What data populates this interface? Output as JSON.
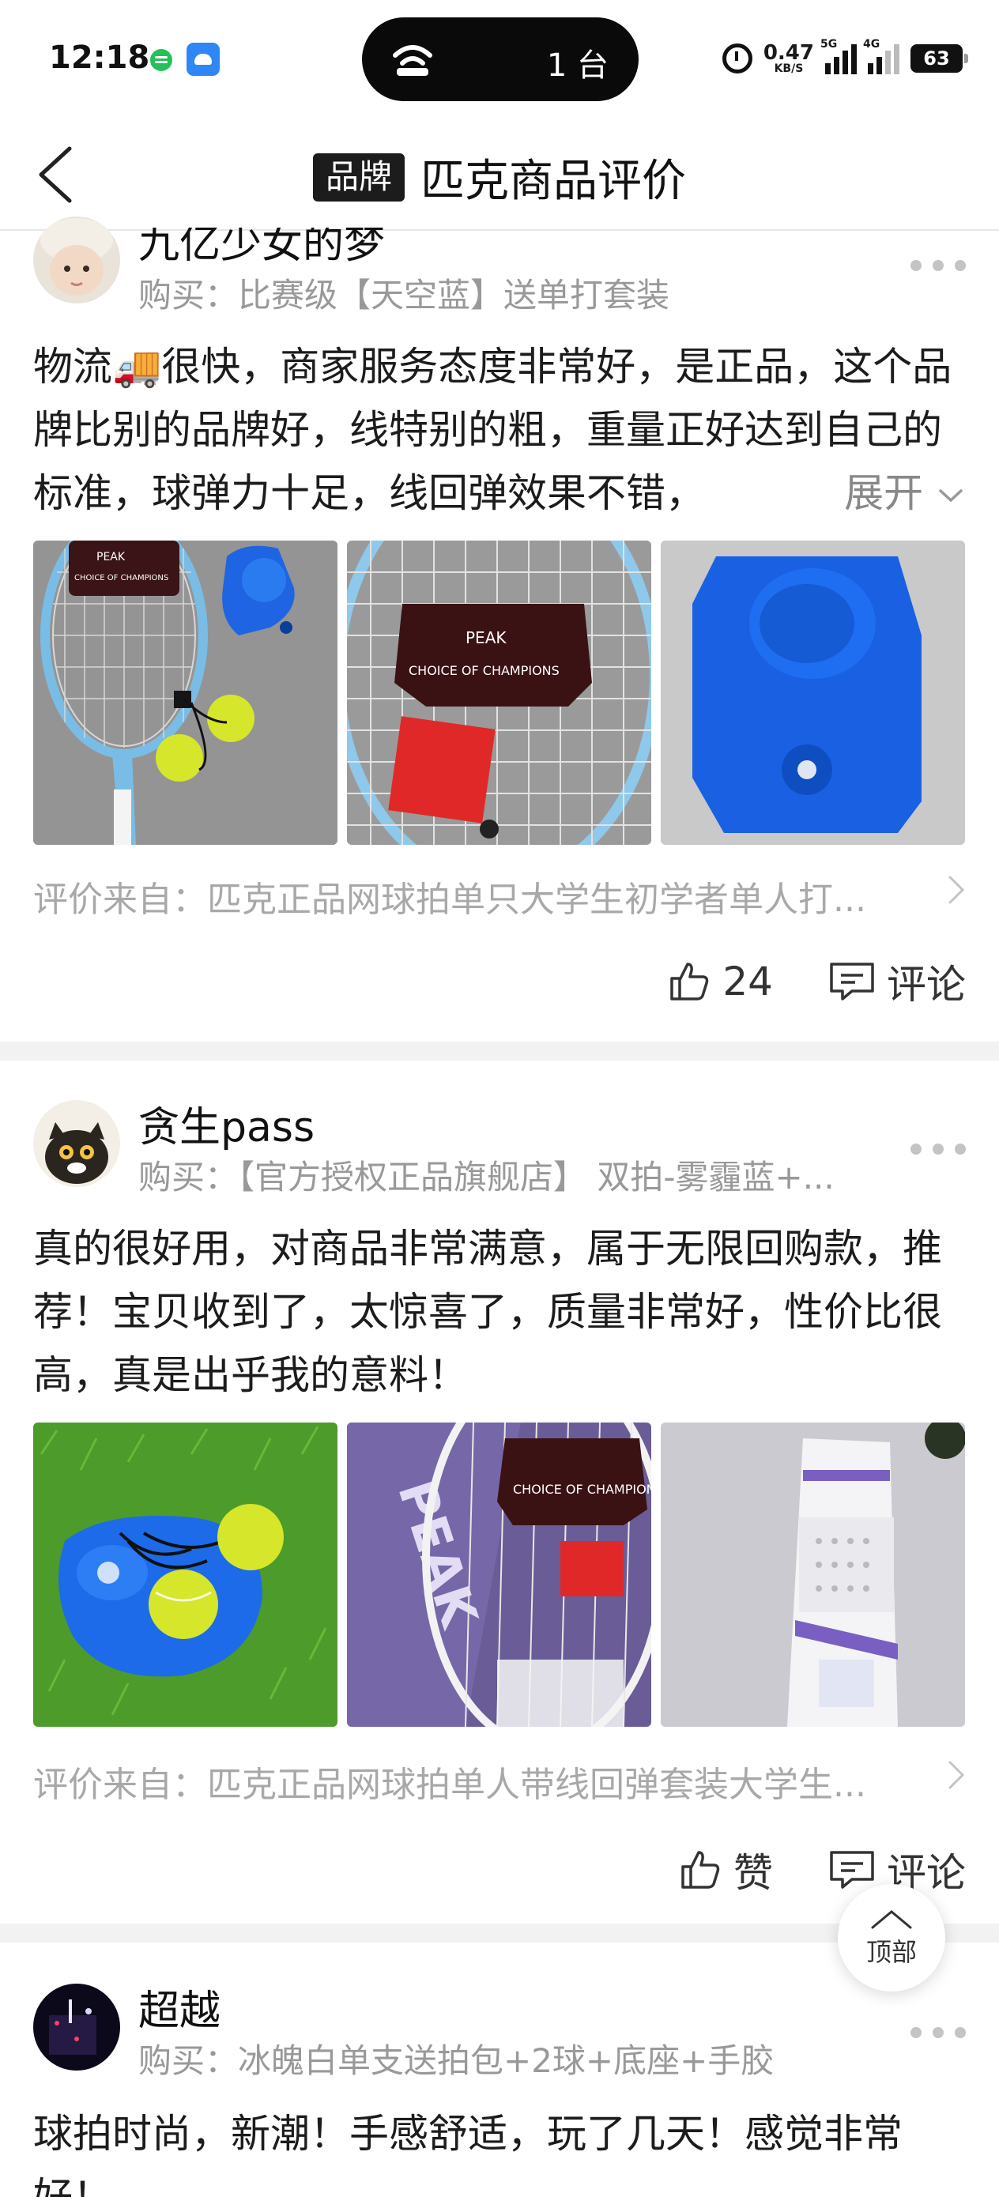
{
  "status_bar": {
    "time": "12:18",
    "pill_text": "1 台",
    "net_speed": "0.47",
    "net_unit": "KB/S",
    "sig1_label": "5G",
    "sig2_label": "4G",
    "battery": "63"
  },
  "header": {
    "brand_badge": "品牌",
    "title": "匹克商品评价"
  },
  "reviews": [
    {
      "username": "九亿少女的梦",
      "purchase": "购买：比赛级【天空蓝】送单打套装",
      "text": "物流🚚很快，商家服务态度非常好，是正品，这个品牌比别的品牌好，线特别的粗，重量正好达到自己的标准，球弹力十足，线回弹效果不错，",
      "expand": "展开",
      "photos": [
        "racket-and-trainer-base",
        "racket-choice-of-champions",
        "blue-trainer-base"
      ],
      "photo_texts": [
        "PEAK",
        "CHOICE OF CHAMPIONS"
      ],
      "source": "评价来自：匹克正品网球拍单只大学生初学者单人打...",
      "likes": "24",
      "comment": "评论"
    },
    {
      "username": "贪生pass",
      "purchase": "购买：【官方授权正品旗舰店】 双拍-雾霾蓝+...",
      "text": "真的很好用，对商品非常满意，属于无限回购款，推荐！宝贝收到了，太惊喜了，质量非常好，性价比很高，真是出乎我的意料！",
      "photos": [
        "trainer-on-grass",
        "racket-bag-purple",
        "grip-tape-package"
      ],
      "photo_texts": [
        "PEAK",
        "CHOICE OF CHAMPIONS"
      ],
      "source": "评价来自：匹克正品网球拍单人带线回弹套装大学生...",
      "likes": "赞",
      "comment": "评论"
    },
    {
      "username": "超越",
      "purchase": "购买：冰魄白单支送拍包+2球+底座+手胶",
      "text": "球拍时尚，新潮！手感舒适，玩了几天！感觉非常好！"
    }
  ],
  "top_button": "顶部",
  "colors": {
    "accent_blue": "#1565e0",
    "tennis_ball": "#d6e62a",
    "muted_text": "#999999"
  }
}
